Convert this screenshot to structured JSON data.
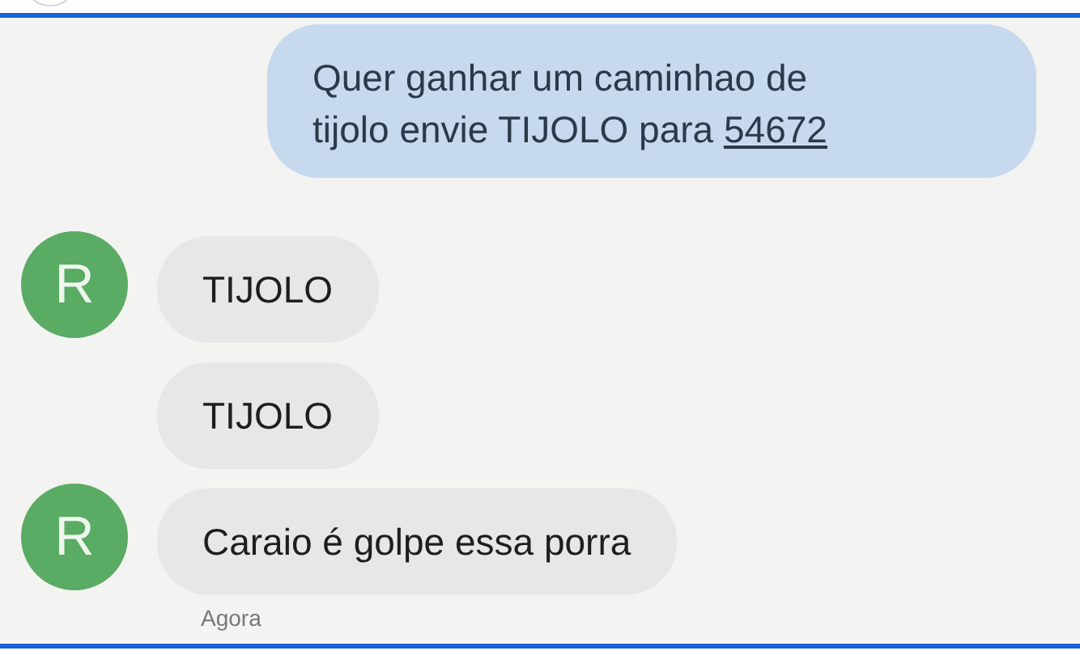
{
  "messages": [
    {
      "kind": "sent",
      "parts": [
        {
          "text": "Quer ganhar um caminhao de tijolo envie TIJOLO para "
        },
        {
          "text": "54672",
          "link": true
        }
      ]
    },
    {
      "kind": "received",
      "avatar": "R",
      "parts": [
        {
          "text": "TIJOLO"
        }
      ]
    },
    {
      "kind": "received",
      "parts": [
        {
          "text": "TIJOLO"
        }
      ]
    },
    {
      "kind": "received",
      "avatar": "R",
      "parts": [
        {
          "text": "Caraio é golpe essa porra"
        }
      ]
    }
  ],
  "timestamp": "Agora"
}
